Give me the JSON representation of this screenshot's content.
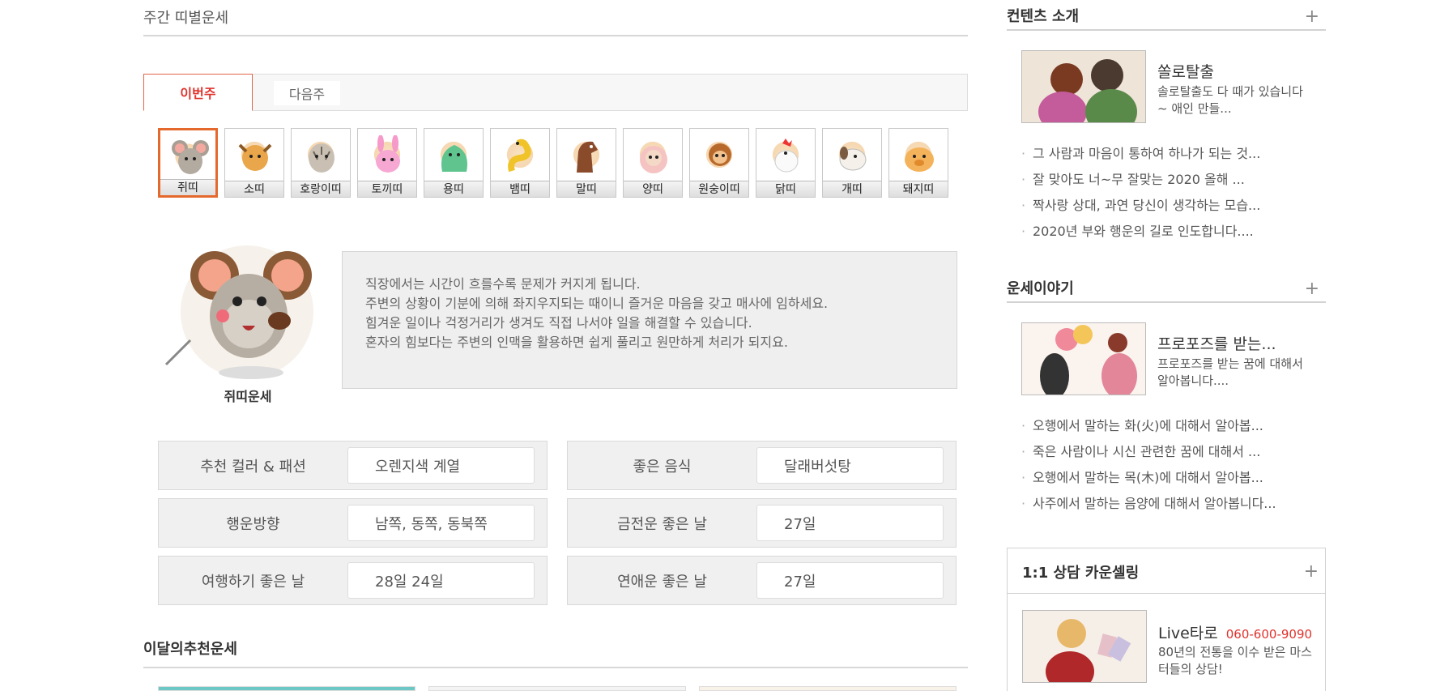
{
  "main": {
    "title": "주간 띠별운세",
    "tabs": [
      {
        "label": "이번주"
      },
      {
        "label": "다음주"
      }
    ],
    "zodiacs": [
      {
        "label": "쥐띠"
      },
      {
        "label": "소띠"
      },
      {
        "label": "호랑이띠"
      },
      {
        "label": "토끼띠"
      },
      {
        "label": "용띠"
      },
      {
        "label": "뱀띠"
      },
      {
        "label": "말띠"
      },
      {
        "label": "양띠"
      },
      {
        "label": "원숭이띠"
      },
      {
        "label": "닭띠"
      },
      {
        "label": "개띠"
      },
      {
        "label": "돼지띠"
      }
    ],
    "fortune": {
      "label": "쥐띠운세",
      "lines": [
        "직장에서는 시간이 흐를수록 문제가 커지게 됩니다.",
        "주변의 상황이 기분에 의해 좌지우지되는 때이니 즐거운 마음을 갖고 매사에 임하세요.",
        "힘겨운 일이나 걱정거리가 생겨도 직접 나서야 일을 해결할 수 있습니다.",
        "혼자의 힘보다는 주변의 인맥을 활용하면 쉽게 풀리고 원만하게 처리가 되지요."
      ]
    },
    "info": [
      {
        "key": "추천 컬러 & 패션",
        "value": "오렌지색 계열"
      },
      {
        "key": "좋은 음식",
        "value": "달래버섯탕"
      },
      {
        "key": "행운방향",
        "value": "남쪽, 동쪽, 동북쪽"
      },
      {
        "key": "금전운 좋은 날",
        "value": "27일"
      },
      {
        "key": "여행하기 좋은 날",
        "value": "28일 24일"
      },
      {
        "key": "연애운 좋은 날",
        "value": "27일"
      }
    ],
    "recommend_title": "이달의추천운세"
  },
  "side": {
    "contents": {
      "title": "컨텐츠 소개",
      "plus": "+",
      "feature": {
        "title": "쏠로탈출",
        "desc": "솔로탈출도 다 때가 있습니다~ 애인 만들..."
      },
      "items": [
        "그 사람과 마음이 통하여 하나가 되는 것...",
        "잘 맞아도 너~무 잘맞는 2020 올해 ...",
        "짝사랑 상대, 과연 당신이 생각하는 모습...",
        "2020년 부와 행운의 길로 인도합니다...."
      ]
    },
    "story": {
      "title": "운세이야기",
      "plus": "+",
      "feature": {
        "title": "프로포즈를 받는...",
        "desc": "프로포즈를 받는 꿈에 대해서 알아봅니다...."
      },
      "items": [
        "오행에서 말하는 화(火)에 대해서 알아봅...",
        "죽은 사람이나 시신 관련한 꿈에 대해서 ...",
        "오행에서 말하는 목(木)에 대해서 알아봅...",
        "사주에서 말하는 음양에 대해서 알아봅니다..."
      ]
    },
    "counsel": {
      "title": "1:1 상담 카운셀링",
      "plus": "+",
      "name": "Live타로",
      "phone": "060-600-9090",
      "desc": "80년의 전통을 이수 받은 마스터들의 상담!"
    }
  }
}
